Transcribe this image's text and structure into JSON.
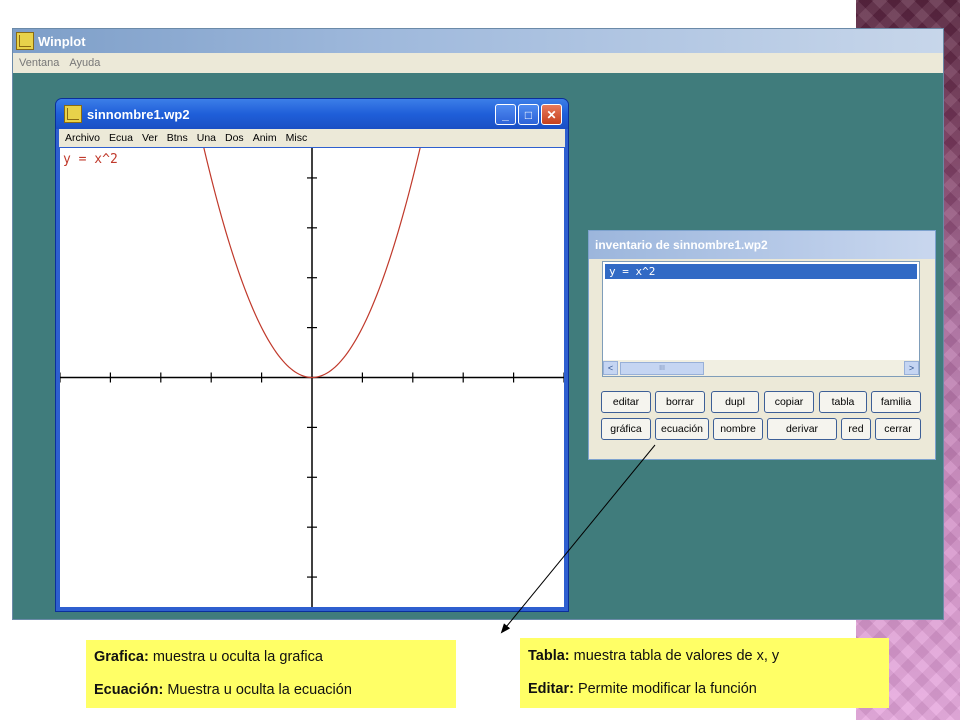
{
  "main_window": {
    "title": "Winplot",
    "menu": [
      "Ventana",
      "Ayuda"
    ]
  },
  "doc_window": {
    "title": "sinnombre1.wp2",
    "menu": [
      "Archivo",
      "Ecua",
      "Ver",
      "Btns",
      "Una",
      "Dos",
      "Anim",
      "Misc"
    ],
    "minimize_symbol": "_",
    "maximize_symbol": "□",
    "close_symbol": "✕",
    "equation_label": "y = x^2"
  },
  "plot": {
    "function": "x^2",
    "x_range": [
      -5,
      5
    ],
    "y_range": [
      -4.6,
      4.6
    ],
    "curve_color": "#c0392b"
  },
  "inventory": {
    "title": "inventario de sinnombre1.wp2",
    "items": [
      "y = x^2"
    ],
    "scroll_left": "<",
    "scroll_right": ">",
    "scroll_thumb": "III",
    "buttons_row1": [
      "editar",
      "borrar",
      "dupl",
      "copiar",
      "tabla",
      "familia"
    ],
    "buttons_row2": [
      "gráfica",
      "ecuación",
      "nombre",
      "derivar",
      "red",
      "cerrar"
    ]
  },
  "notes": {
    "left": {
      "line1_term": "Grafica:",
      "line1_text": " muestra u oculta la grafica",
      "line2_term": "Ecuación:",
      "line2_text": " Muestra u oculta la ecuación"
    },
    "right": {
      "line1_term": "Tabla:",
      "line1_text": " muestra tabla de valores de x, y",
      "line2_term": "Editar:",
      "line2_text": " Permite modificar la función"
    }
  },
  "colors": {
    "desktop_teal": "#407c7c",
    "xp_blue": "#1f5fd9",
    "note_yellow": "#ffff66",
    "selection": "#316ac5"
  }
}
